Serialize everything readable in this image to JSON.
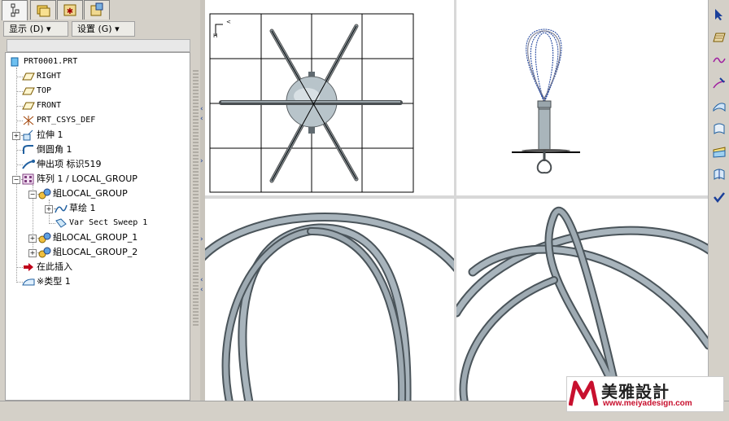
{
  "toolbar": {
    "show_label": "显示 (D) ▾",
    "settings_label": "设置 (G) ▾"
  },
  "tree": {
    "root": "PRT0001.PRT",
    "items": [
      {
        "label": "RIGHT",
        "icon": "datum-plane-icon"
      },
      {
        "label": "TOP",
        "icon": "datum-plane-icon"
      },
      {
        "label": "FRONT",
        "icon": "datum-plane-icon"
      },
      {
        "label": "PRT_CSYS_DEF",
        "icon": "csys-icon"
      },
      {
        "label": "拉伸 1",
        "icon": "extrude-icon"
      },
      {
        "label": "倒圆角 1",
        "icon": "round-icon"
      },
      {
        "label": "伸出项 标识519",
        "icon": "protrusion-icon"
      },
      {
        "label": "阵列 1 / LOCAL_GROUP",
        "icon": "pattern-icon"
      },
      {
        "label": "組LOCAL_GROUP",
        "icon": "group-icon"
      },
      {
        "label": "草绘 1",
        "icon": "sketch-icon"
      },
      {
        "label": "Var Sect Sweep 1",
        "icon": "sweep-icon"
      },
      {
        "label": "組LOCAL_GROUP_1",
        "icon": "group-icon"
      },
      {
        "label": "組LOCAL_GROUP_2",
        "icon": "group-icon"
      },
      {
        "label": "在此插入",
        "icon": "insert-arrow-icon"
      },
      {
        "label": "※类型 1",
        "icon": "quilt-icon"
      }
    ]
  },
  "watermark": {
    "brand": "美雅設計",
    "url": "www.meiyadesign.com"
  },
  "colors": {
    "panel": "#d4d0c8",
    "model": "#a8b4bc",
    "accent": "#1a3f9a",
    "insert": "#c0001a"
  }
}
